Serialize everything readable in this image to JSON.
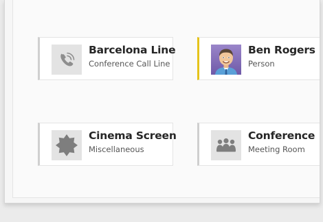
{
  "cards": [
    {
      "title": "Barcelona Line",
      "subtitle": "Conference Call Line",
      "icon": "phone-icon",
      "accent_color": "#cfcfcf"
    },
    {
      "title": "Ben Rogers",
      "subtitle": "Person",
      "icon": "avatar",
      "accent_color": "#e5c31a"
    },
    {
      "title": "Cinema Screen",
      "subtitle": "Miscellaneous",
      "icon": "starburst-icon",
      "accent_color": "#cfcfcf"
    },
    {
      "title": "Conference",
      "subtitle": "Meeting Room",
      "icon": "meeting-room-icon",
      "accent_color": "#cfcfcf"
    }
  ]
}
